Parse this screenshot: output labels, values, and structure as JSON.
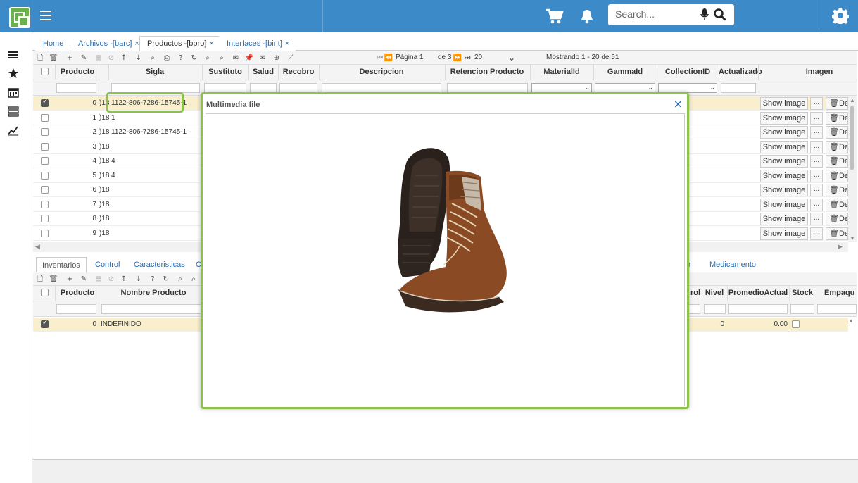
{
  "topbar": {
    "search_placeholder": "Search...",
    "brand_color": "#3d8ac9",
    "icons": [
      "menu-icon",
      "cart-icon",
      "bell-icon",
      "microphone-icon",
      "search-icon",
      "gear-icon"
    ]
  },
  "sidebar": {
    "icons": [
      "list-icon",
      "star-icon",
      "calendar-icon",
      "tasks-icon",
      "chart-icon"
    ]
  },
  "tabs": [
    {
      "label": "Home"
    },
    {
      "label": "Archivos -[barc]",
      "close": "×"
    },
    {
      "label": "Productos -[bpro]",
      "close": "×"
    },
    {
      "label": "Interfaces -[bint]",
      "close": "×"
    }
  ],
  "pager": {
    "page_label": "Página 1",
    "of_label": "de 3",
    "page_size": "20",
    "showing": "Mostrando 1 - 20 de 51"
  },
  "grid": {
    "columns": [
      "Producto",
      "Sigla",
      "Sustituto",
      "Salud",
      "Recobro",
      "Descripcion",
      "Retencion Producto",
      "MaterialId",
      "GammaId",
      "CollectionID",
      "Actualizado",
      "Imagen"
    ],
    "rows": [
      {
        "producto": "0",
        "code": ")18",
        "sigla": "1122-806-7286-15745-1",
        "selected": true
      },
      {
        "producto": "1",
        "code": ")18",
        "sigla": "1",
        "selected": false
      },
      {
        "producto": "2",
        "code": ")18",
        "sigla": "1122-806-7286-15745-1",
        "selected": false
      },
      {
        "producto": "3",
        "code": ")18",
        "sigla": "",
        "selected": false
      },
      {
        "producto": "4",
        "code": ")18",
        "sigla": "4",
        "selected": false
      },
      {
        "producto": "5",
        "code": ")18",
        "sigla": "4",
        "selected": false
      },
      {
        "producto": "6",
        "code": ")18",
        "sigla": "",
        "selected": false
      },
      {
        "producto": "7",
        "code": ")18",
        "sigla": "",
        "selected": false
      },
      {
        "producto": "8",
        "code": ")18",
        "sigla": "",
        "selected": false
      },
      {
        "producto": "9",
        "code": ")18",
        "sigla": "",
        "selected": false
      }
    ],
    "show_image_label": "Show image",
    "dots_label": "...",
    "delete_label": "🗑De"
  },
  "detail_tabs": [
    {
      "label": "Inventarios"
    },
    {
      "label": "Control"
    },
    {
      "label": "Caracteristicas"
    },
    {
      "label": "C"
    },
    {
      "label": "n"
    },
    {
      "label": "Medicamento"
    }
  ],
  "detail_grid": {
    "columns": [
      "Producto",
      "Nombre Producto",
      "rol",
      "Nivel",
      "PromedioActual",
      "Stock",
      "Empaqu"
    ],
    "row": {
      "producto": "0",
      "nombre": "INDEFINIDO",
      "nivel": "0",
      "promedio": "0.00"
    }
  },
  "modal": {
    "title": "Multimedia file",
    "close": "×"
  }
}
